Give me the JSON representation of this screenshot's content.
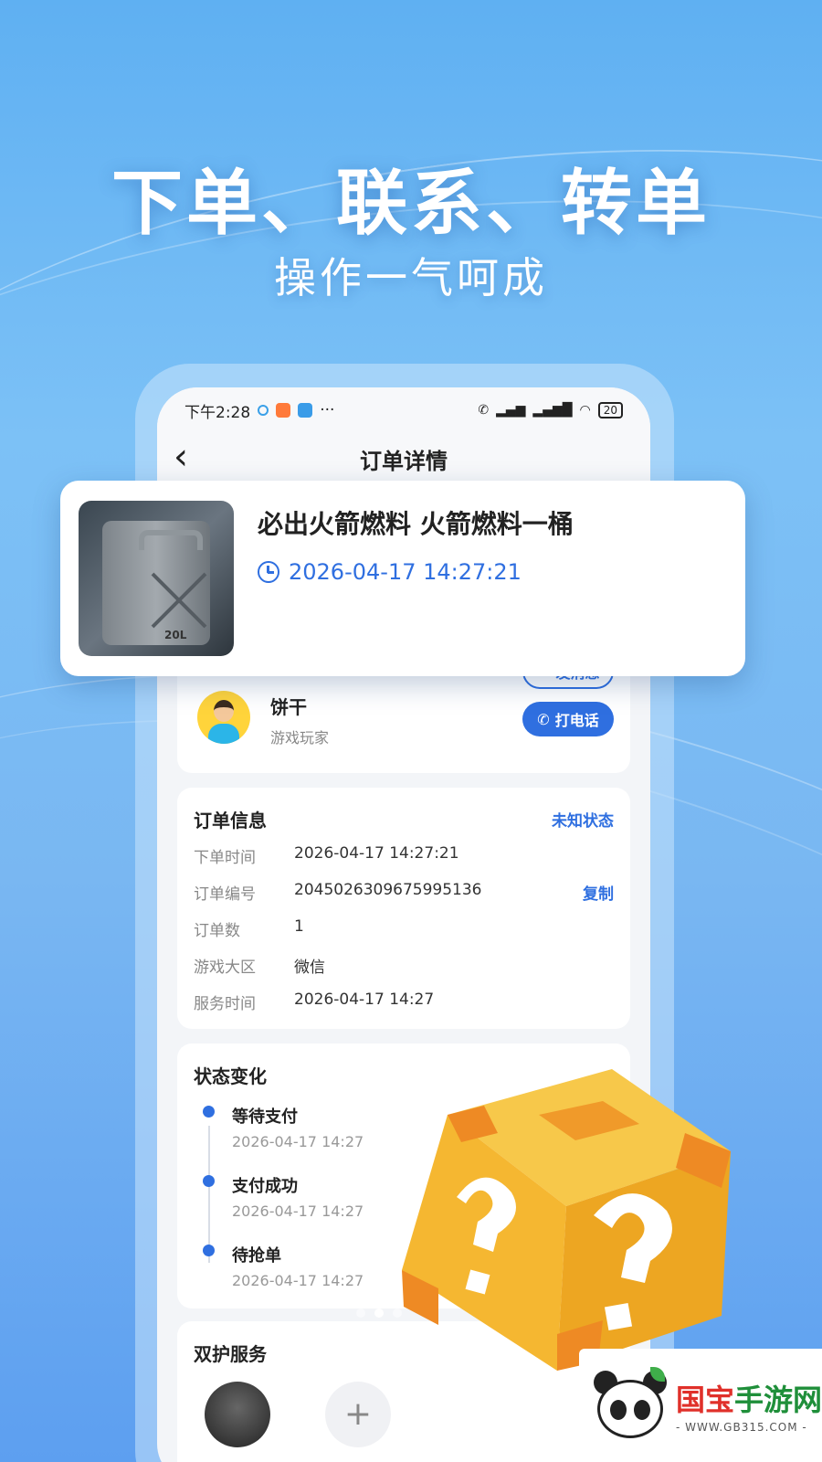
{
  "hero": {
    "title": "下单、联系、转单",
    "subtitle": "操作一气呵成"
  },
  "status_bar": {
    "time": "下午2:28",
    "more": "···",
    "battery": "20"
  },
  "nav": {
    "back": "‹",
    "title": "订单详情"
  },
  "product": {
    "title": "必出火箭燃料 火箭燃料一桶",
    "time": "2026-04-17 14:27:21",
    "image_text": "20L"
  },
  "contact": {
    "name": "饼干",
    "role": "游戏玩家",
    "message_button": "发消息",
    "call_button": "打电话"
  },
  "order_info": {
    "title": "订单信息",
    "status": "未知状态",
    "rows": [
      {
        "label": "下单时间",
        "value": "2026-04-17 14:27:21"
      },
      {
        "label": "订单编号",
        "value": "2045026309675995136"
      },
      {
        "label": "订单数",
        "value": "1"
      },
      {
        "label": "游戏大区",
        "value": "微信"
      },
      {
        "label": "服务时间",
        "value": "2026-04-17 14:27"
      }
    ],
    "copy_label": "复制"
  },
  "status_change": {
    "title": "状态变化",
    "items": [
      {
        "label": "等待支付",
        "time": "2026-04-17 14:27"
      },
      {
        "label": "支付成功",
        "time": "2026-04-17 14:27"
      },
      {
        "label": "待抢单",
        "time": "2026-04-17 14:27"
      }
    ]
  },
  "guard_service": {
    "title": "双护服务",
    "add_symbol": "+"
  },
  "watermark": {
    "name_red": "国宝",
    "name_green": "手游网",
    "url": "- WWW.GB315.COM -"
  },
  "colors": {
    "accent": "#2f6fe0",
    "background_top": "#5fb0f2",
    "box_gold": "#f5b731"
  }
}
